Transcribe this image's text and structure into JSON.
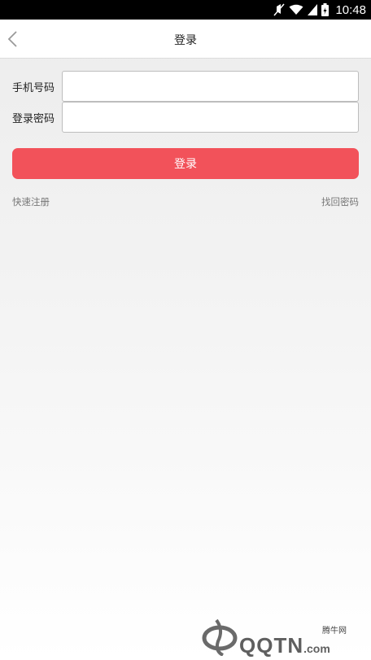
{
  "status_bar": {
    "time": "10:48",
    "icons": [
      "mute-icon",
      "wifi-icon",
      "signal-icon",
      "battery-icon"
    ]
  },
  "header": {
    "title": "登录",
    "back_icon": "chevron-left-icon"
  },
  "form": {
    "phone": {
      "label": "手机号码",
      "value": "",
      "placeholder": ""
    },
    "password": {
      "label": "登录密码",
      "value": "",
      "placeholder": ""
    }
  },
  "login_button": {
    "label": "登录",
    "color": "#f2525a"
  },
  "links": {
    "register": "快速注册",
    "forgot_password": "找回密码"
  },
  "watermark": {
    "site_name": "腾牛网",
    "logo_text": "QQTN",
    "logo_suffix": ".com"
  }
}
